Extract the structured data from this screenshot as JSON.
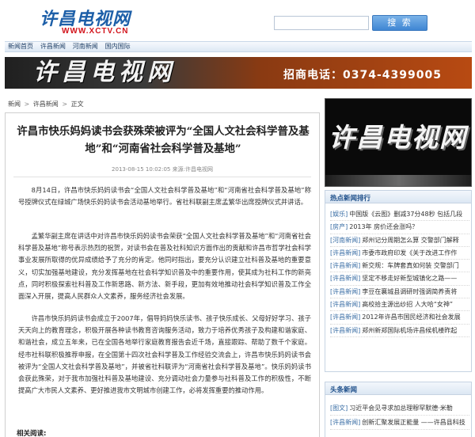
{
  "header": {
    "logo_text": "许昌电视网",
    "logo_url": "WWW.XCTV.CN",
    "search_placeholder": "",
    "search_button": "搜 索"
  },
  "nav": {
    "items": [
      "新闻首页",
      "许昌新闻",
      "河南新闻",
      "国内国际"
    ]
  },
  "banner": {
    "title": "许昌电视网",
    "phone": "招商电话：0374-4399005"
  },
  "breadcrumb": {
    "items": [
      "新闻",
      "许昌新闻",
      "正文"
    ],
    "separator": ">"
  },
  "article": {
    "title": "许昌市快乐妈妈读书会获殊荣被评为“全国人文社会科学普及基地”和“河南省社会科学普及基地”",
    "meta": "2013-08-15 10:02:05 来源:许昌电视网",
    "paragraphs": [
      "8月14日，许昌市快乐妈妈读书会“全国人文社会科学普及基地”和“河南省社会科学普及基地”称号授牌仪式在绿城广场快乐妈妈读书会活动基地举行。省社科联副主席孟繁华出席授牌仪式并讲话。",
      "孟繁华副主席在讲话中对许昌市快乐妈妈读书会荣获“全国人文社会科学普及基地”和“河南省社会科学普及基地”称号表示热烈的祝贺，对读书会在普及社科知识方面作出的贡献和许昌市哲学社会科学事业发展所取得的优异成绩给予了充分的肯定。他同时指出，要充分认识建立社科普及基地的重要意义，切实加强基地建设，充分发挥基地在社会科学知识普及中的重要作用，使其成为社科工作的新亮点，同时积极探索社科普及工作新思路、新方法、新手段，更加有效地推动社会科学知识普及工作全面深入开展，提高人民群众人文素养，服务经济社会发展。",
      "许昌市快乐妈妈读书会成立于2007年，倡导妈妈快乐读书、孩子快乐成长、父母好好学习、孩子天天向上的教育理念，积极开展各种读书教育咨询服务活动，致力于培养优秀孩子及构建和谐家庭、和谐社会，成立五年来，已在全国各地举行家庭教育报告会近千场，直接跟踪、帮助了数千个家庭。经市社科联积极推荐申报，在全国第十四次社会科学普及工作经验交流会上，许昌市快乐妈妈读书会被评为“全国人文社会科学普及基地”，并被省社科联评为“河南省社会科学普及基地”。快乐妈妈读书会获此殊荣，对于我市加强社科普及基地建设、充分调动社会力量参与社科普及工作的积极性，不断提高广大市民人文素养、更好推进我市文明城市创建工作，必将发挥重要的推动作用。"
    ],
    "related_label": "相关阅读:"
  },
  "sidebar": {
    "ad_title": "许昌电视网",
    "hot": {
      "title": "热点新闻排行",
      "items": [
        {
          "cat": "[娱乐]",
          "text": "中国版《云图》删减37分48秒 包括几段"
        },
        {
          "cat": "[房产]",
          "text": "2013年 房价还会涨吗？"
        },
        {
          "cat": "[河南新闻]",
          "text": "郑州记分周期怎么算 交警部门解释"
        },
        {
          "cat": "[许昌新闻]",
          "text": "市委市政府印发《关于改进工作作"
        },
        {
          "cat": "[许昌新闻]",
          "text": "新交规：车牌套真如何装 交警部门"
        },
        {
          "cat": "[许昌新闻]",
          "text": "坚定不移走好新型城镇化之路——"
        },
        {
          "cat": "[许昌新闻]",
          "text": "李豆在襄城县调研时强调简养责将"
        },
        {
          "cat": "[许昌新闻]",
          "text": "高校拾主源出纱招 人大哈“女神”"
        },
        {
          "cat": "[许昌新闻]",
          "text": "2012年许昌市国民经济和社会发展"
        },
        {
          "cat": "[许昌新闻]",
          "text": "郑州新郑国际机场许昌候机楼昨起"
        }
      ]
    },
    "news": {
      "title": "头条新闻",
      "items": [
        {
          "cat": "[图文]",
          "text": "习近平会见寻求加总理穆罕默德·米勒"
        },
        {
          "cat": "[许昌新闻]",
          "text": "创新汇聚发展正能量 ——许昌县科技"
        }
      ]
    }
  }
}
